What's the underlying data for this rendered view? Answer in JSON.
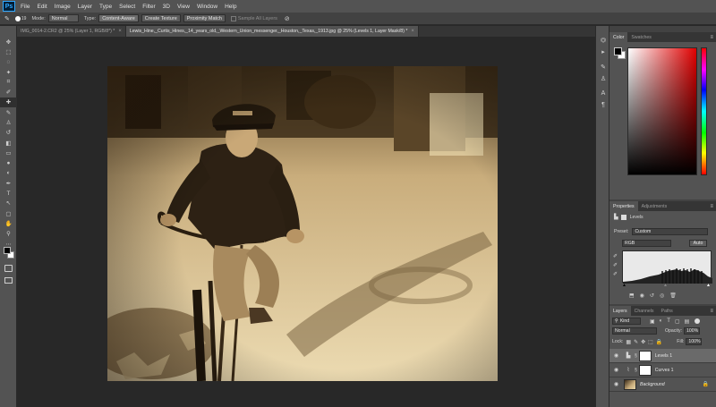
{
  "app": {
    "logo": "Ps"
  },
  "menu": [
    "File",
    "Edit",
    "Image",
    "Layer",
    "Type",
    "Select",
    "Filter",
    "3D",
    "View",
    "Window",
    "Help"
  ],
  "options": {
    "brush_size": "19",
    "mode_label": "Mode:",
    "mode_value": "Normal",
    "type_label": "Type:",
    "type_buttons": [
      "Content-Aware",
      "Create Texture",
      "Proximity Match"
    ],
    "sample_all": "Sample All Layers"
  },
  "tabs": [
    {
      "label": "IMG_0014-2.CR2 @ 25% (Layer 1, RGB/8*) *",
      "active": false
    },
    {
      "label": "Lewis_Hine,_Curtis_Hines,_14_years_old,_Western_Union_messenger,_Houston,_Texas,_1913.jpg @ 25% (Levels 1, Layer Mask/8) *",
      "active": true
    }
  ],
  "color_panel": {
    "tabs": [
      "Color",
      "Swatches"
    ],
    "active": "Color"
  },
  "properties": {
    "tabs": [
      "Properties",
      "Adjustments"
    ],
    "title": "Levels",
    "preset_label": "Preset:",
    "preset_value": "Custom",
    "channel": "RGB",
    "auto": "Auto"
  },
  "layers_panel": {
    "tabs": [
      "Layers",
      "Channels",
      "Paths"
    ],
    "kind": "Kind",
    "blend": "Normal",
    "opacity_label": "Opacity:",
    "opacity": "100%",
    "lock_label": "Lock:",
    "fill_label": "Fill:",
    "fill": "100%",
    "layers": [
      {
        "name": "Levels 1",
        "selected": true,
        "type": "adjustment"
      },
      {
        "name": "Curves 1",
        "selected": false,
        "type": "adjustment"
      },
      {
        "name": "Background",
        "selected": false,
        "type": "image"
      }
    ]
  },
  "colors": {
    "accent": "#31a8ff",
    "sepia_light": "#e9d6a8",
    "sepia_dark": "#3a2a18"
  }
}
